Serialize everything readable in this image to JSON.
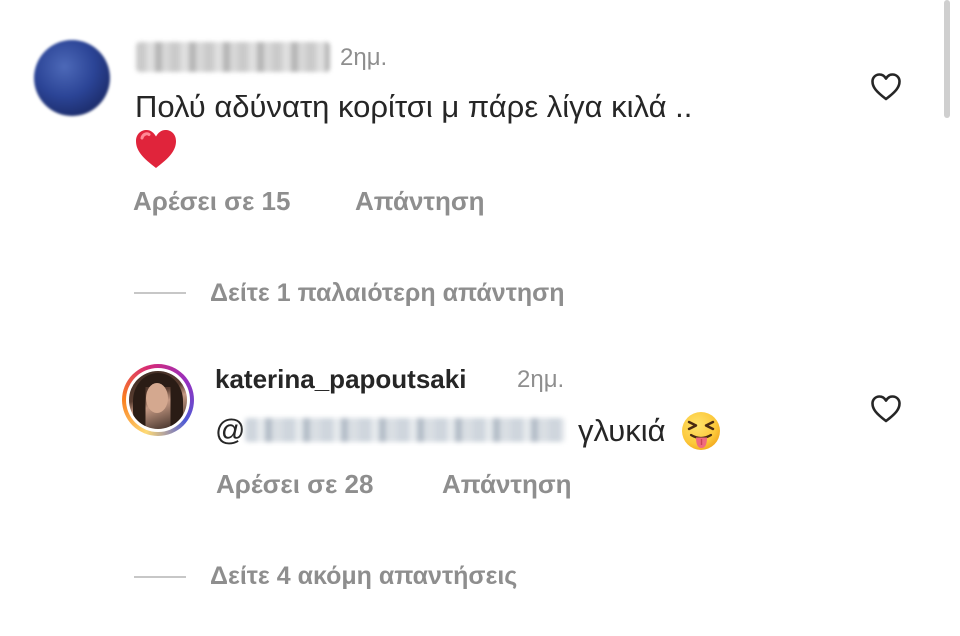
{
  "colors": {
    "text_primary": "#262626",
    "text_secondary": "#8e8e8e",
    "heart_red": "#e0245e"
  },
  "comment1": {
    "time": "2ημ.",
    "text": "Πολύ αδύνατη κορίτσι μ πάρε λίγα κιλά ..",
    "emoji": "red-heart",
    "likes": "Αρέσει σε 15",
    "reply_label": "Απάντηση"
  },
  "view_older": "Δείτε 1 παλαιότερη απάντηση",
  "reply1": {
    "username": "katerina_papoutsaki",
    "time": "2ημ.",
    "mention_prefix": "@",
    "text": "γλυκιά",
    "emoji": "squinting-face-with-tongue",
    "likes": "Αρέσει σε 28",
    "reply_label": "Απάντηση"
  },
  "view_more": "Δείτε 4 ακόμη απαντήσεις",
  "icons": {
    "like": "heart-outline-icon"
  }
}
